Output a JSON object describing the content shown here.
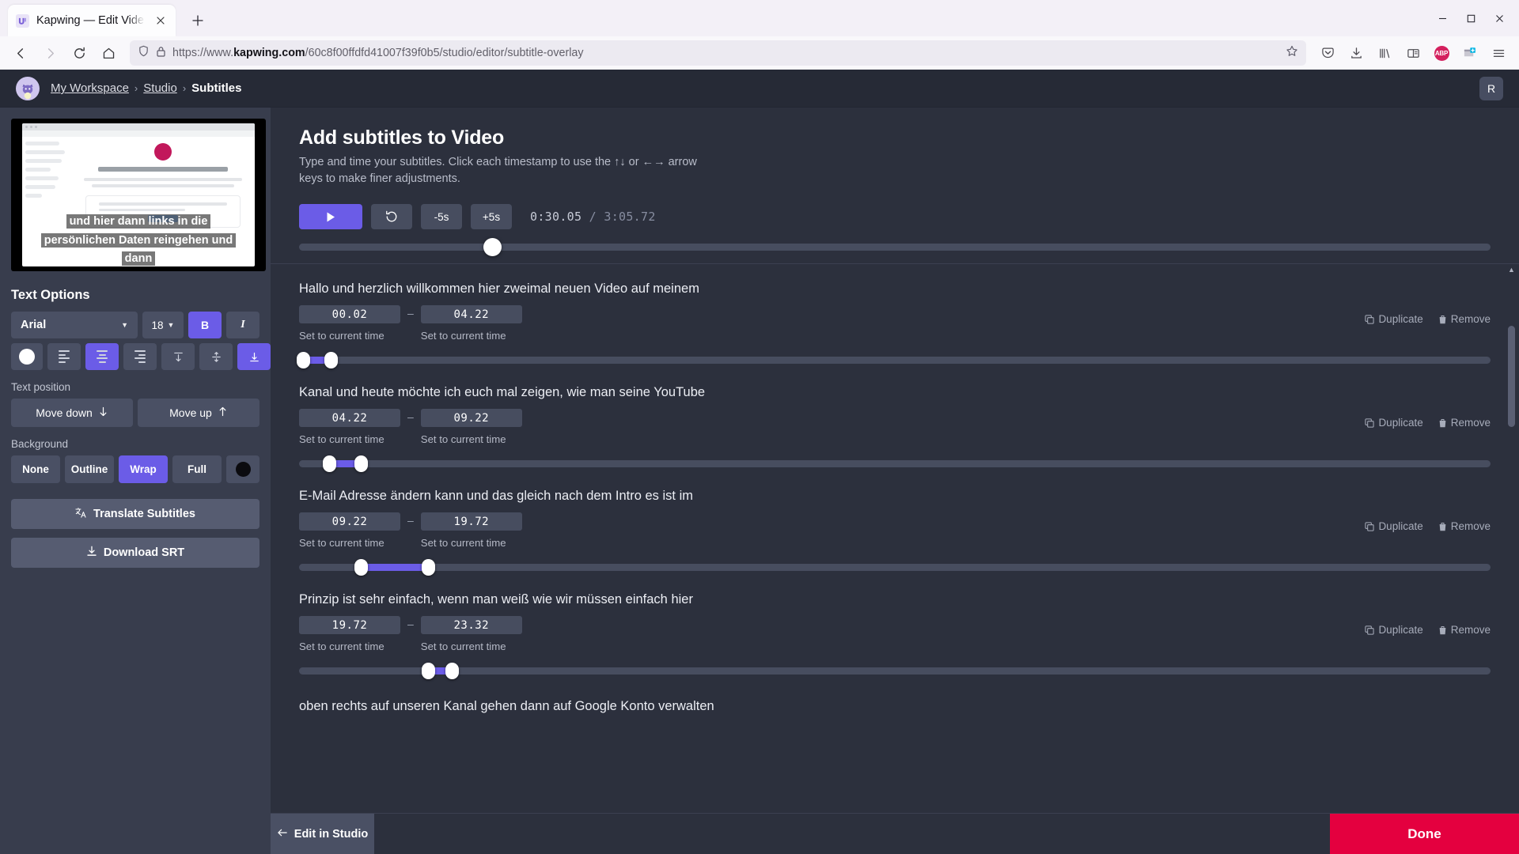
{
  "browser": {
    "tab": {
      "title": "Kapwing — Edit Video and Crea",
      "favicon_icon": "kapwing-favicon",
      "close_icon": "close-icon"
    },
    "new_tab_label": "+",
    "nav": {
      "back_icon": "back-arrow-icon",
      "forward_icon": "forward-arrow-icon",
      "reload_icon": "reload-icon",
      "home_icon": "home-icon"
    },
    "url": {
      "shield_icon": "shield-icon",
      "lock_icon": "padlock-icon",
      "prefix": "https://www.",
      "domain": "kapwing.com",
      "path": "/60c8f00ffdfd41007f39f0b5/studio/editor/subtitle-overlay",
      "bookmark_icon": "star-icon"
    },
    "toolbar_icons": [
      "pocket-icon",
      "download-icon",
      "library-icon",
      "reader-view-icon",
      "adblock-plus-icon",
      "extension-icon",
      "hamburger-menu-icon"
    ],
    "adblock_label": "ABP",
    "window": {
      "minimize": "–",
      "maximize": "☐",
      "close": "✕"
    }
  },
  "app_header": {
    "avatar_icon": "cat-avatar",
    "breadcrumbs": [
      {
        "label": "My Workspace"
      },
      {
        "label": "Studio"
      },
      {
        "label": "Subtitles"
      }
    ],
    "separator": "›",
    "user_initial": "R"
  },
  "preview": {
    "subtitle_lines": [
      "und hier dann links in die",
      "persönlichen Daten reingehen und",
      "dann"
    ]
  },
  "text_options": {
    "title": "Text Options",
    "font": {
      "value": "Arial",
      "chevron_icon": "chevron-down-icon"
    },
    "size": {
      "value": "18",
      "chevron_icon": "chevron-down-icon"
    },
    "bold": {
      "label": "B",
      "active": true
    },
    "italic": {
      "label": "I",
      "active": false
    },
    "color_swatch": "#ffffff",
    "align_icons": [
      "align-left-icon",
      "align-center-icon",
      "align-right-icon"
    ],
    "align_active_index": 1,
    "valign_icons": [
      "valign-top-icon",
      "valign-middle-icon",
      "valign-bottom-icon"
    ],
    "valign_active_index": 2,
    "position": {
      "label": "Text position",
      "move_down": "Move down",
      "move_down_icon": "arrow-down-icon",
      "move_up": "Move up",
      "move_up_icon": "arrow-up-icon"
    },
    "background": {
      "label": "Background",
      "options": [
        "None",
        "Outline",
        "Wrap",
        "Full"
      ],
      "active": "Wrap",
      "color_swatch": "#0b0b0f"
    },
    "translate_button": {
      "label": "Translate Subtitles",
      "icon": "translate-icon"
    },
    "download_button": {
      "label": "Download SRT",
      "icon": "download-icon"
    }
  },
  "main": {
    "title": "Add subtitles to Video",
    "subtitle": "Type and time your subtitles. Click each timestamp to use the ↑↓ or ←→ arrow keys to make finer adjustments.",
    "player": {
      "play_icon": "play-icon",
      "restart_icon": "restart-icon",
      "back5_label": "-5s",
      "forward5_label": "+5s",
      "current_time": "0:30.05",
      "separator": "/",
      "total_time": "3:05.72",
      "scrub_percent": 16.2
    },
    "row_labels": {
      "set_to_current_time": "Set to current time",
      "duplicate": "Duplicate",
      "duplicate_icon": "duplicate-icon",
      "remove": "Remove",
      "remove_icon": "trash-icon",
      "dash": "–"
    },
    "cues": [
      {
        "text": "Hallo und herzlich willkommen hier zweimal neuen Video auf meinem",
        "start": "00.02",
        "end": "04.22",
        "start_pct": 0.0,
        "end_pct": 2.3
      },
      {
        "text": "Kanal und heute möchte ich euch mal zeigen, wie man seine YouTube",
        "start": "04.22",
        "end": "09.22",
        "start_pct": 2.3,
        "end_pct": 5.0
      },
      {
        "text": "E-Mail Adresse ändern kann und das gleich nach dem Intro es ist im",
        "start": "09.22",
        "end": "19.72",
        "start_pct": 5.0,
        "end_pct": 10.6
      },
      {
        "text": "Prinzip ist sehr einfach, wenn man weiß wie wir müssen einfach hier",
        "start": "19.72",
        "end": "23.32",
        "start_pct": 10.6,
        "end_pct": 12.6
      },
      {
        "text": "oben rechts auf unseren Kanal gehen dann auf Google Konto verwalten",
        "start": "",
        "end": "",
        "start_pct": 0,
        "end_pct": 0
      }
    ]
  },
  "bottom": {
    "edit_in_studio": "Edit in Studio",
    "edit_in_studio_icon": "arrow-left-icon",
    "done": "Done"
  },
  "colors": {
    "accent_purple": "#6b5ce7",
    "done_red": "#e4003f",
    "panel_bg": "#2c303d",
    "sidebar_bg": "#383d4d",
    "control_bg": "#4a5064"
  }
}
